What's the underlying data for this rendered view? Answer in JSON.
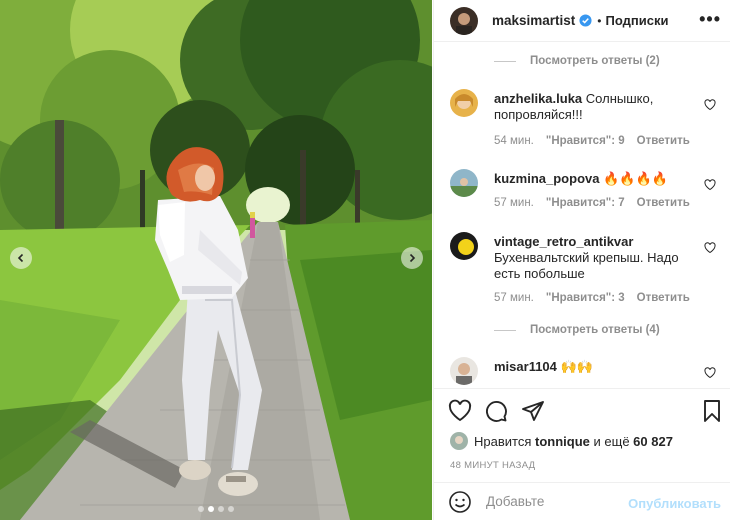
{
  "post": {
    "username": "maksimartist",
    "verified": true,
    "separator": "•",
    "follow_label": "Подписки",
    "more_label": "•••"
  },
  "comments": {
    "view_replies_1": "Посмотреть ответы (2)",
    "items": [
      {
        "username": "anzhelika.luka",
        "text": "Солнышко, попровляйся!!!",
        "time": "54 мин.",
        "likes": "\"Нравится\": 9",
        "reply": "Ответить"
      },
      {
        "username": "kuzmina_popova",
        "text": "🔥🔥🔥🔥",
        "time": "57 мин.",
        "likes": "\"Нравится\": 7",
        "reply": "Ответить"
      },
      {
        "username": "vintage_retro_antikvar",
        "text": "Бухенвальтский крепыш. Надо есть побольше",
        "time": "57 мин.",
        "likes": "\"Нравится\": 3",
        "reply": "Ответить"
      },
      {
        "username": "misar1104",
        "text": "🙌🙌"
      }
    ],
    "view_replies_2": "Посмотреть ответы (4)"
  },
  "actions": {
    "likes_prefix": "Нравится",
    "liked_by": "tonnique",
    "likes_suffix": "и ещё",
    "likes_count": "60 827",
    "timestamp": "48 МИНУТ НАЗАД"
  },
  "add_comment": {
    "placeholder": "Добавьте",
    "publish_label": "Опубликовать"
  },
  "colors": {
    "verified": "#3897f0",
    "publish_disabled": "#b2dffc",
    "secondary_text": "#8e8e8e"
  },
  "carousel": {
    "slides": 4,
    "active_slide": 1
  }
}
